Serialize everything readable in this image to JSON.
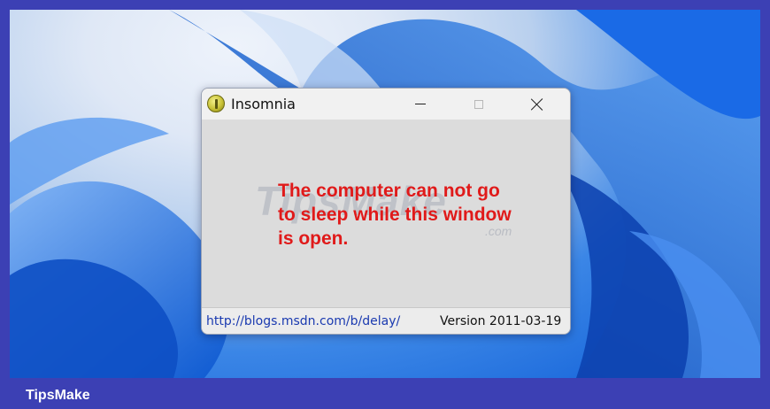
{
  "window": {
    "title": "Insomnia",
    "icon": "insomnia-app-icon",
    "controls": {
      "minimize": "minimize-icon",
      "maximize": "maximize-icon",
      "close": "close-icon"
    },
    "message": "The computer can not go to sleep while this window is open.",
    "link": "http://blogs.msdn.com/b/delay/",
    "version": "Version 2011-03-19"
  },
  "watermark": {
    "text": "TipsMake",
    "suffix": ".com"
  },
  "footer": {
    "brand": "TipsMake"
  },
  "colors": {
    "frame": "#3c40b4",
    "message": "#e01a1a",
    "link": "#1a3ab0",
    "window_bg": "#dcdcdc"
  }
}
